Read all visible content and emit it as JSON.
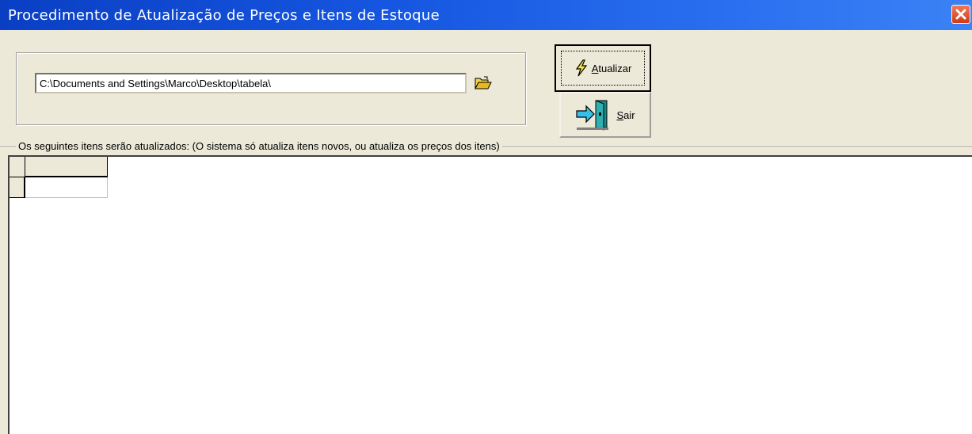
{
  "window": {
    "title": "Procedimento de Atualização de Preços e Itens de Estoque"
  },
  "path": {
    "value": "C:\\Documents and Settings\\Marco\\Desktop\\tabela\\"
  },
  "buttons": {
    "atualizar_label_prefix": "A",
    "atualizar_label_rest": "tualizar",
    "sair_label_prefix": "S",
    "sair_label_rest": "air"
  },
  "section": {
    "legend": "Os seguintes itens serão atualizados:  (O sistema só atualiza itens novos, ou atualiza os preços dos itens)"
  },
  "grid": {
    "rows": [
      [
        ""
      ]
    ]
  },
  "icons": {
    "close": "close-icon",
    "folder": "folder-open-icon",
    "atualizar": "lightning-icon",
    "sair": "exit-door-icon"
  },
  "colors": {
    "titlebar": "#0a3fc4",
    "close": "#d23a16",
    "window_bg": "#ece9d8"
  }
}
